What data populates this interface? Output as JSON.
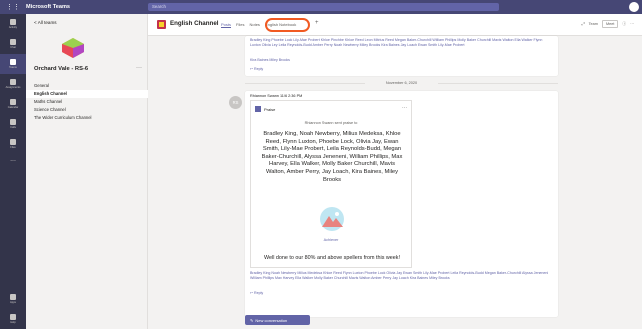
{
  "app": {
    "title": "Microsoft Teams"
  },
  "search": {
    "placeholder": "Search"
  },
  "rail": {
    "items": [
      {
        "label": "Activity",
        "icon": "bell-icon"
      },
      {
        "label": "Chat",
        "icon": "chat-icon"
      },
      {
        "label": "Teams",
        "icon": "teams-icon",
        "active": true
      },
      {
        "label": "Assignments",
        "icon": "backpack-icon"
      },
      {
        "label": "Calendar",
        "icon": "calendar-icon"
      },
      {
        "label": "Calls",
        "icon": "phone-icon"
      },
      {
        "label": "Files",
        "icon": "file-icon"
      }
    ],
    "more": "...",
    "bottom": [
      {
        "label": "Apps",
        "icon": "apps-icon"
      },
      {
        "label": "Help",
        "icon": "help-icon"
      }
    ]
  },
  "sidebar": {
    "back": "< All teams",
    "team_name": "Orchard Vale - RS-6",
    "team_more": "···",
    "channels": [
      {
        "label": "General",
        "active": false
      },
      {
        "label": "English Channel",
        "active": true
      },
      {
        "label": "Maths Channel",
        "active": false
      },
      {
        "label": "Science Channel",
        "active": false
      },
      {
        "label": "The Wider Curriculum Channel",
        "active": false
      }
    ]
  },
  "header": {
    "channel": "English Channel",
    "tabs": [
      {
        "label": "Posts",
        "active": true
      },
      {
        "label": "Files",
        "active": false
      },
      {
        "label": "Notes",
        "active": false
      },
      {
        "label": "English Notebook",
        "active": false
      }
    ],
    "add": "+",
    "meet": "Meet",
    "team_label": "Team"
  },
  "feed": {
    "prev_text": "Bradley King Phoebe Lock Lily-Mae Probert Khloe Pinchbe Khloe Reed Leon Mitrius Reed Megan Baker-Churchill William Phillips Molly Baker Churchill Mavis Walton Ella Walker Flynn Luxton Olivia Ley Leila Reynolds-Budd Amber Perry Noah Newberry Miley Brooks Kira Baines Jay Loach Ewan Smith Lily-Mae Probert",
    "prev_extra": "Kira Baines Miley Brooks",
    "reply": "↩ Reply",
    "date": "November 6, 2020",
    "post": {
      "avatar": "RS",
      "author": "Rhiannon Swann  11/6 2:36 PM",
      "praise_title": "Praise",
      "praise_more": "···",
      "praise_from": "Rhiannon Swann sent praise to",
      "names": "Bradley King, Noah Newberry, Milius Medeksa, Khloe Reed, Flynn Luxton, Phoebe Lock, Olivia Jay, Ewan Smith, Lily-Mae Probert, Leila Reynolds-Budd, Megan Baker-Churchill, Alyssa Jeneneni, William Phillips, Max Harvey, Ella Walker, Molly Baker Churchill, Mavis Walton, Amber Perry, Jay Loach, Kira Baines, Miley Brooks",
      "badge": "Achiever",
      "message": "Well done to our 80% and above spellers from this week!",
      "footer_text": "Bradley King Noah Newberry Milius Medeksa Khloe Reed Flynn Luxton Phoebe Lock Olivia Jay Ewan Smith Lily-Mae Probert Leila Reynolds-Budd Megan Baker-Churchill Alyssa Jeneneni William Phillips Max Harvey Ella Walker Molly Baker Churchill Mavis Walton Amber Perry Jay Loach Kira Baines Miley Brooks",
      "reply": "↩ Reply"
    },
    "new_conversation": "New conversation"
  },
  "colors": {
    "brand": "#464775",
    "accent": "#6264a7",
    "highlight": "#f15a22"
  }
}
